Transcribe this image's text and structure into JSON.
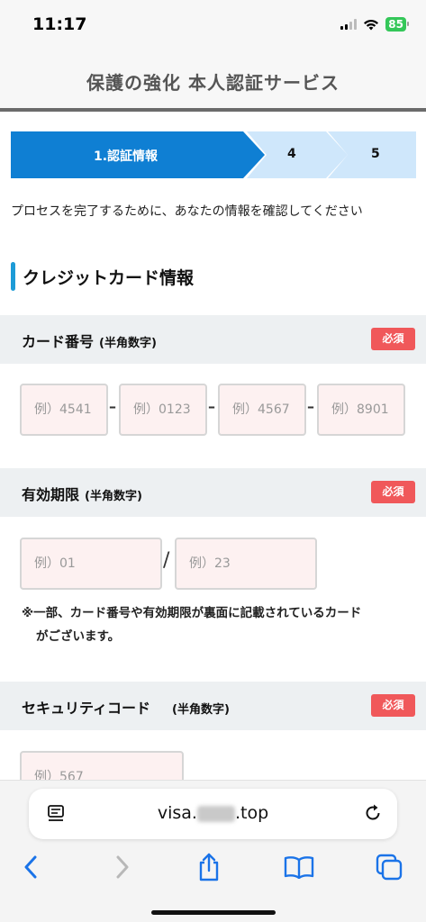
{
  "status_bar": {
    "time": "11:17",
    "battery": "85"
  },
  "header": {
    "title": "保護の強化 本人認証サービス"
  },
  "steps": [
    {
      "label": "1.認証情報",
      "active": true
    },
    {
      "label": "4",
      "active": false
    },
    {
      "label": "5",
      "active": false
    }
  ],
  "intro_text": "プロセスを完了するために、あなたの情報を確認してください",
  "section_title": "クレジットカード情報",
  "card_number": {
    "label": "カード番号",
    "sub": "(半角数字)",
    "required": "必須",
    "placeholders": [
      "例）4541",
      "例）0123",
      "例）4567",
      "例）8901"
    ],
    "separator": "–"
  },
  "expiry": {
    "label": "有効期限",
    "sub": "(半角数字)",
    "required": "必須",
    "placeholders": [
      "例）01",
      "例）23"
    ],
    "separator": "/"
  },
  "note": {
    "line1": "※一部、カード番号や有効期限が裏面に記載されているカード",
    "line2": "がございます。"
  },
  "security_code": {
    "label": "セキュリティコード",
    "sub": "(半角数字)",
    "required": "必須",
    "placeholder": "例）567"
  },
  "browser": {
    "url_prefix": "visa.",
    "url_suffix": ".top"
  },
  "colors": {
    "step_active": "#0f7fd3",
    "step_inactive": "#cfe7fb",
    "required_badge": "#f0585a",
    "accent_bar": "#1d9bd7"
  }
}
